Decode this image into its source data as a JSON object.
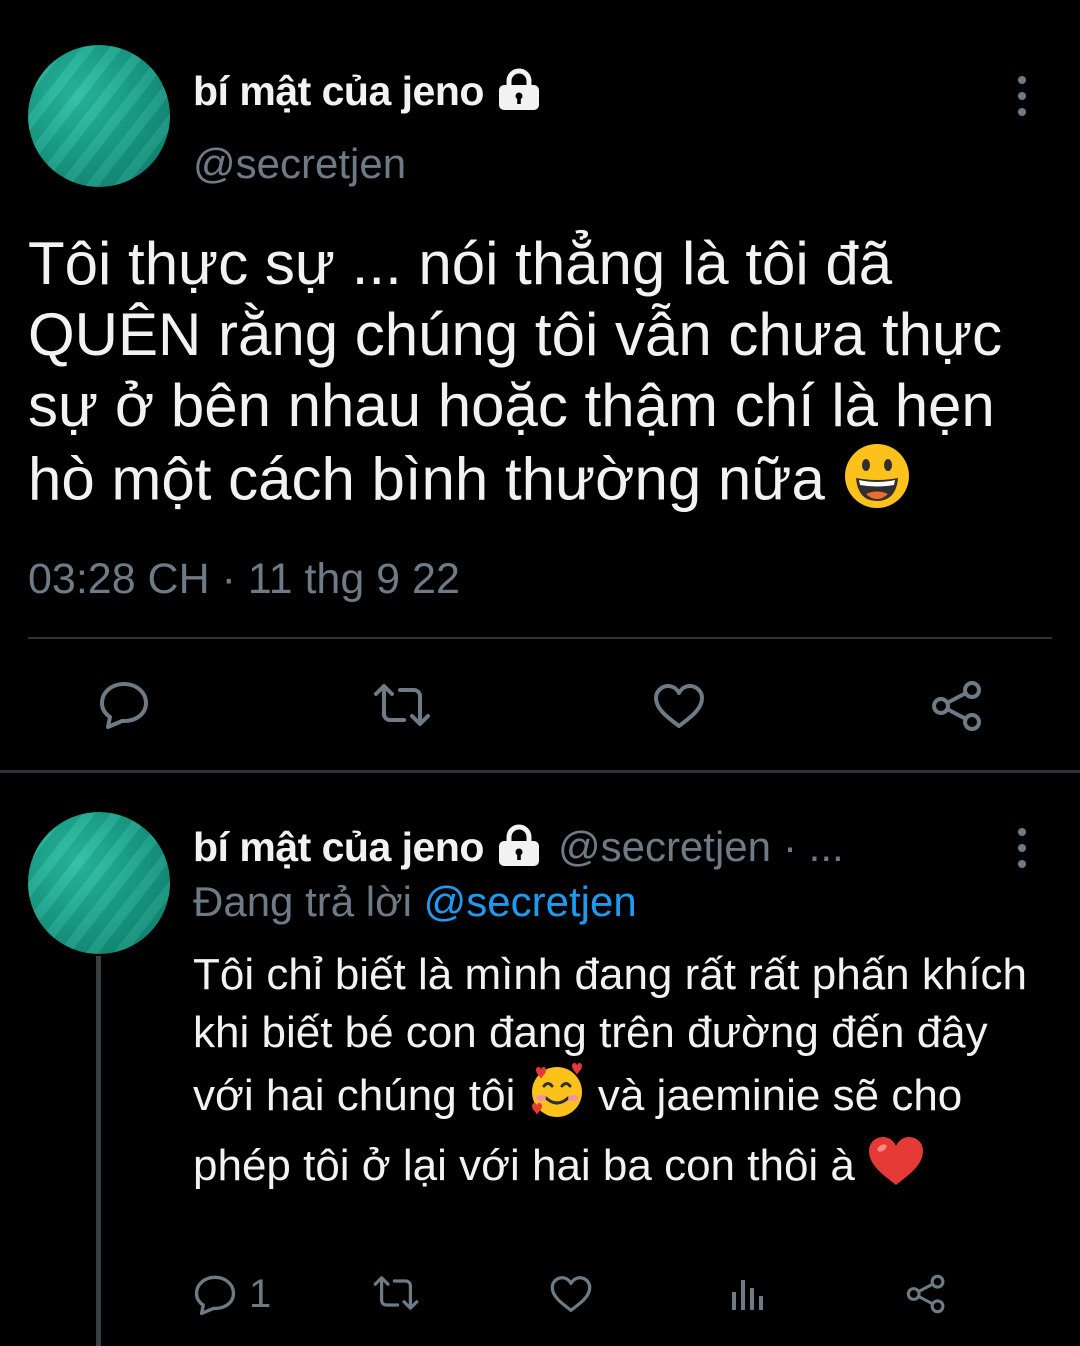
{
  "main_tweet": {
    "display_name": "bí mật của jeno",
    "handle": "@secretjen",
    "text": "Tôi thực sự ... nói thẳng là tôi đã QUÊN rằng chúng tôi vẫn chưa thực sự ở bên nhau hoặc thậm chí là hẹn hò một cách bình thường nữa",
    "emoji": "grinning-face",
    "timestamp": "03:28 CH · 11 thg 9 22",
    "actions": [
      "reply-icon",
      "retweet-icon",
      "like-icon",
      "share-icon"
    ]
  },
  "reply": {
    "display_name": "bí mật của jeno",
    "handle": "@secretjen",
    "separator": "· ...",
    "replying_prefix": "Đang trả lời",
    "replying_to": "@secretjen",
    "text_part1": "Tôi chỉ biết là mình đang rất rất phấn khích khi biết bé con đang trên đường đến đây với hai chúng tôi",
    "text_part2": "và jaeminie sẽ cho phép tôi ở lại với hai ba con thôi à",
    "emoji1": "smiling-face-with-hearts",
    "emoji2": "red-heart",
    "reply_count": "1",
    "actions": [
      "reply-icon",
      "retweet-icon",
      "like-icon",
      "analytics-icon",
      "share-icon"
    ]
  },
  "colors": {
    "background": "#000000",
    "text": "#f2f2f2",
    "muted": "#6e7a86",
    "link": "#1d9bf0",
    "avatar": "#1aa38c"
  }
}
